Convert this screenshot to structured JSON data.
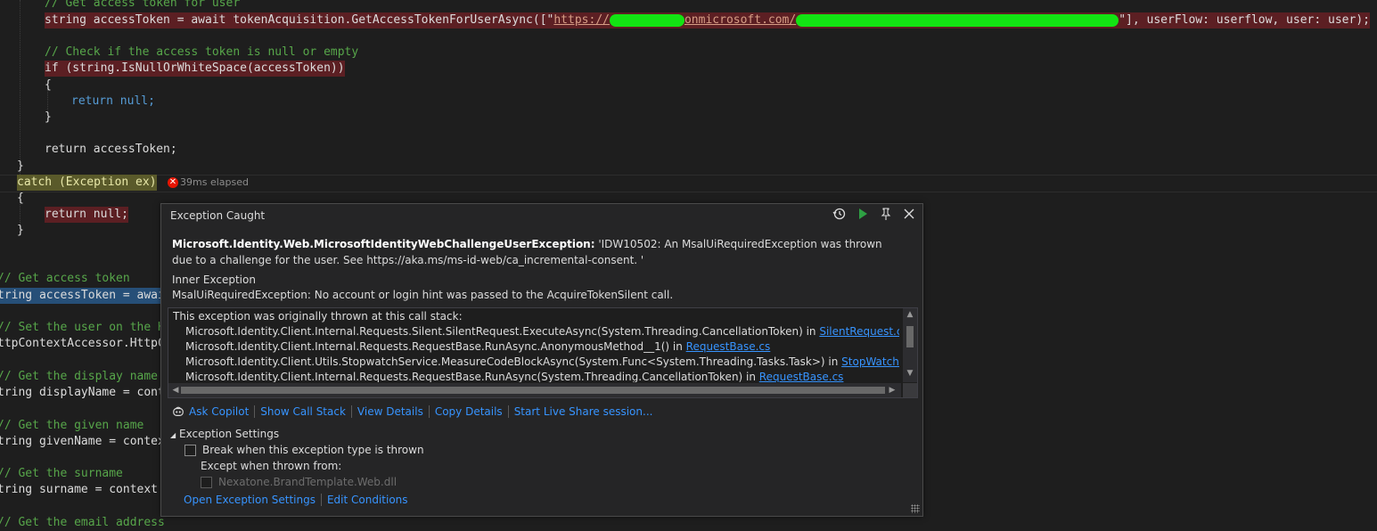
{
  "code": {
    "comment_get_token": "// Get access token for user",
    "line_token_pre": "string accessToken = await tokenAcquisition.GetAccessTokenForUserAsync([\"",
    "line_token_url1": "https://",
    "line_token_url2": "onmicrosoft.com/",
    "line_token_post": "\"], userFlow: userflow, user: user);",
    "comment_check": "// Check if the access token is null or empty",
    "line_if": "if (string.IsNullOrWhiteSpace(accessToken))",
    "open_brace": "{",
    "line_return_null": "return null;",
    "close_brace": "}",
    "line_return_token": "return accessToken;",
    "line_catch": "catch (Exception ex)",
    "elapsed": "39ms elapsed",
    "left_lines": [
      "// Get access token",
      "tring accessToken = awai",
      "// Set the user on the HT",
      "ttpContextAccessor.HttpC",
      "// Get the display name",
      "tring displayName = cont",
      "// Get the given name",
      "tring givenName = contex",
      "// Get the surname",
      "tring surname = context.",
      "// Get the email address"
    ]
  },
  "popup": {
    "title": "Exception Caught",
    "exception_type": "Microsoft.Identity.Web.MicrosoftIdentityWebChallengeUserException:",
    "exception_message": " 'IDW10502: An MsalUiRequiredException was thrown due to a challenge for the user. See https://aka.ms/ms-id-web/ca_incremental-consent. '",
    "inner_title": "Inner Exception",
    "inner_message": "MsalUiRequiredException: No account or login hint was passed to the AcquireTokenSilent call.",
    "stack_header": "This exception was originally thrown at this call stack:",
    "stack": [
      {
        "text": "Microsoft.Identity.Client.Internal.Requests.Silent.SilentRequest.ExecuteAsync(System.Threading.CancellationToken) in ",
        "file": "SilentRequest.cs"
      },
      {
        "text": "Microsoft.Identity.Client.Internal.Requests.RequestBase.RunAsync.AnonymousMethod__1() in ",
        "file": "RequestBase.cs"
      },
      {
        "text": "Microsoft.Identity.Client.Utils.StopwatchService.MeasureCodeBlockAsync(System.Func<System.Threading.Tasks.Task>) in ",
        "file": "StopWatchService.cs"
      },
      {
        "text": "Microsoft.Identity.Client.Internal.Requests.RequestBase.RunAsync(System.Threading.CancellationToken) in ",
        "file": "RequestBase.cs"
      }
    ],
    "links": {
      "ask_copilot": "Ask Copilot",
      "show_call_stack": "Show Call Stack",
      "view_details": "View Details",
      "copy_details": "Copy Details",
      "live_share": "Start Live Share session..."
    },
    "settings_title": "Exception Settings",
    "break_label": "Break when this exception type is thrown",
    "except_label": "Except when thrown from:",
    "module_label": "Nexatone.BrandTemplate.Web.dll",
    "open_settings": "Open Exception Settings",
    "edit_conditions": "Edit Conditions"
  },
  "colors": {
    "keyword": "#569cd6",
    "comment": "#57a64a",
    "link": "#3794ff",
    "error": "#e51400",
    "redaction": "#13e313"
  }
}
